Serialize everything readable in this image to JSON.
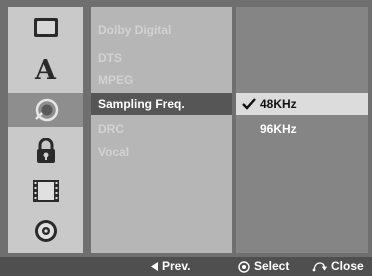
{
  "icon_menu": {
    "items": [
      {
        "icon": "display-icon",
        "active": false
      },
      {
        "icon": "language-icon",
        "glyph": "A",
        "active": false
      },
      {
        "icon": "audio-icon",
        "active": true
      },
      {
        "icon": "lock-icon",
        "active": false
      },
      {
        "icon": "film-icon",
        "active": false
      },
      {
        "icon": "disc-icon",
        "active": false
      }
    ]
  },
  "submenu": {
    "items": [
      {
        "label": "Dolby Digital"
      },
      {
        "label": "DTS"
      },
      {
        "label": "MPEG"
      },
      {
        "label": "Sampling Freq.",
        "active": true
      },
      {
        "label": "DRC"
      },
      {
        "label": "Vocal"
      }
    ]
  },
  "options": {
    "items": [
      {
        "label": "48KHz",
        "selected": true
      },
      {
        "label": "96KHz",
        "selected": false
      }
    ]
  },
  "help_bar": {
    "prev_label": "Prev.",
    "select_label": "Select",
    "close_label": "Close"
  },
  "colors": {
    "background": "#6f6f6f",
    "icon_column": "#c9c9c9",
    "icon_active": "#8e8e8e",
    "submenu_column": "#b6b6b6",
    "submenu_active": "#565656",
    "options_column": "#858585",
    "option_selected": "#dcdcdc",
    "help_bar": "#4f4f4f"
  }
}
